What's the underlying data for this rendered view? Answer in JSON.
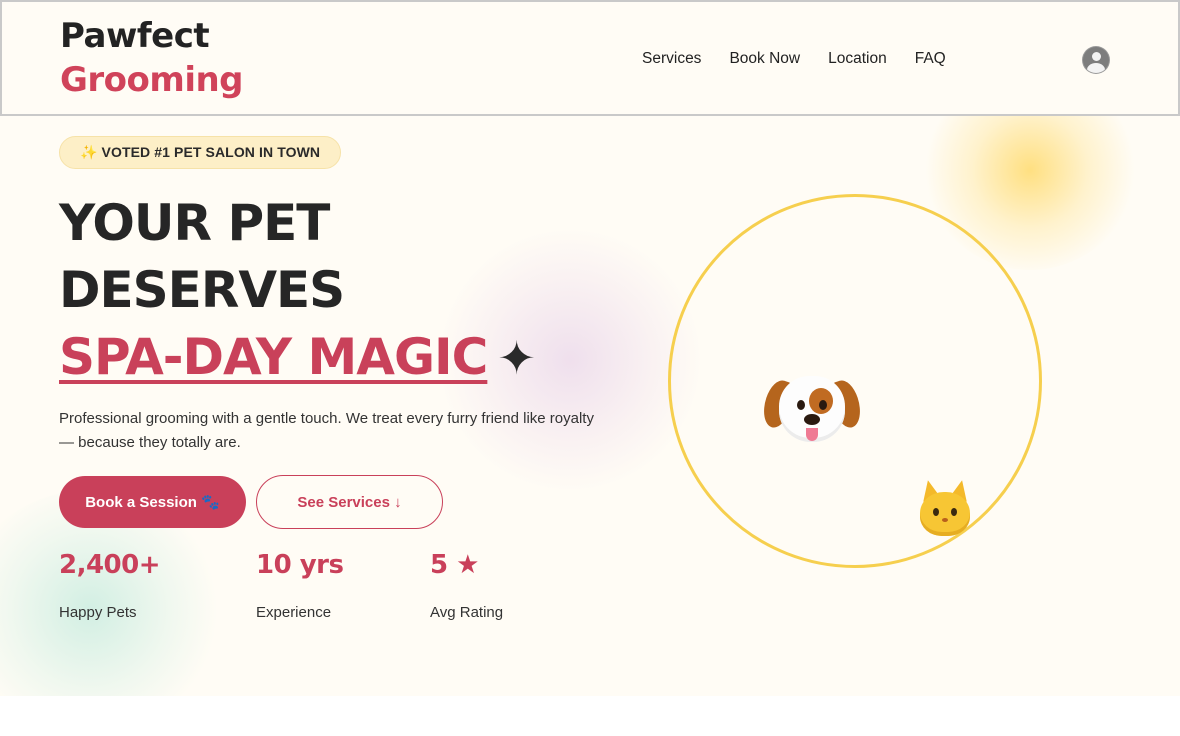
{
  "brand": {
    "line1": "Pawfect",
    "line2": "Grooming",
    "accent_color": "#d0435a"
  },
  "nav": {
    "items": [
      {
        "label": "Services"
      },
      {
        "label": "Book Now"
      },
      {
        "label": "Location"
      },
      {
        "label": "FAQ"
      }
    ],
    "account_icon": "user-avatar-icon"
  },
  "hero": {
    "badge": "✨ VOTED #1 PET SALON IN TOWN",
    "headline_line1": "YOUR PET",
    "headline_line2": "DESERVES",
    "headline_accent": "SPA-DAY MAGIC",
    "sparkle_glyph": "✦",
    "subtext": "Professional grooming with a gentle touch. We treat every furry friend like royalty — because they totally are.",
    "primary_button": "Book a Session 🐾",
    "secondary_button": "See Services ↓",
    "stats": [
      {
        "value": "2,400+",
        "label": "Happy Pets"
      },
      {
        "value": "10 yrs",
        "label": "Experience"
      },
      {
        "value": "5 ★",
        "label": "Avg Rating"
      }
    ]
  },
  "illustration": {
    "main_icon": "dog-face-icon",
    "orbit_icon": "cat-face-icon",
    "ring_color": "#f6cf4e"
  },
  "colors": {
    "background": "#fffcf5",
    "primary": "#c9405a",
    "badge_bg": "#fdefc7",
    "text": "#262626"
  }
}
